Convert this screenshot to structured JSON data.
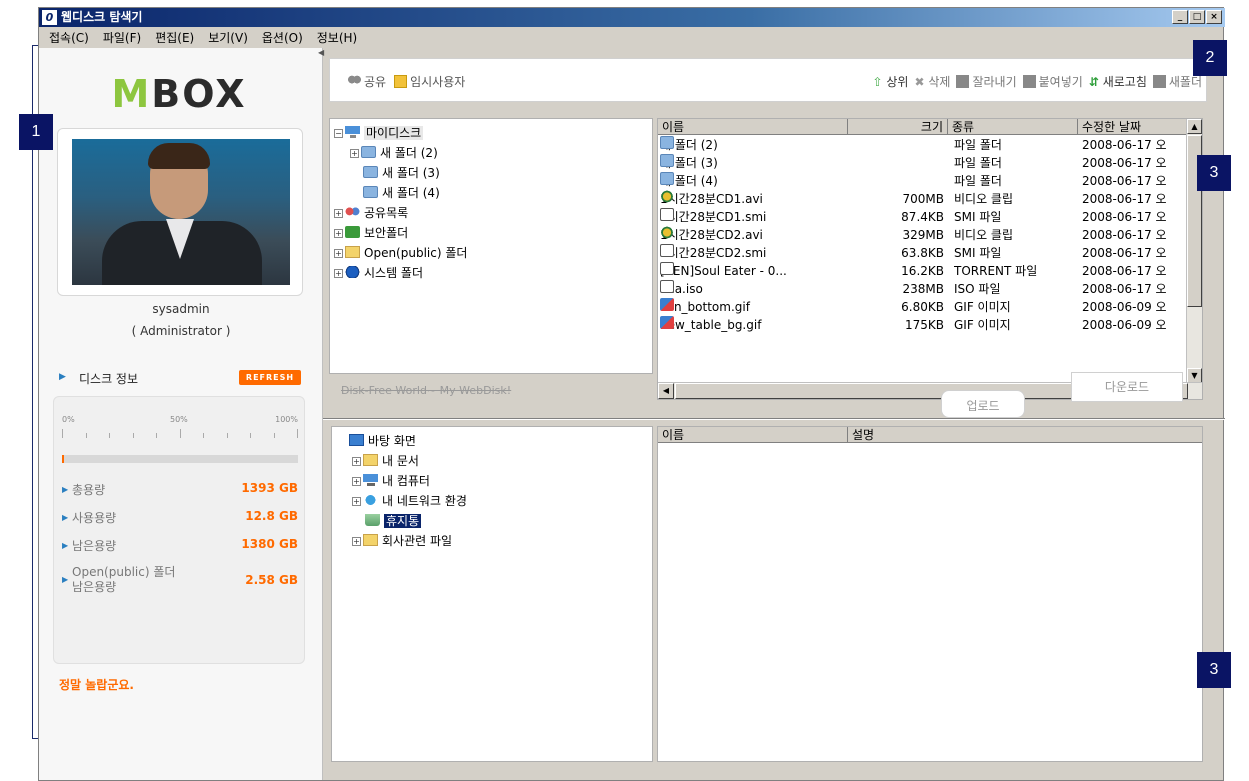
{
  "window": {
    "title": "웹디스크 탐색기",
    "app_icon": "0",
    "controls": [
      "_",
      "□",
      "×"
    ]
  },
  "menu": [
    "접속(C)",
    "파일(F)",
    "편집(E)",
    "보기(V)",
    "옵션(O)",
    "정보(H)"
  ],
  "left_panel": {
    "logo_m": "M",
    "logo_rest": "BOX",
    "username": "sysadmin",
    "role": "( Administrator )",
    "disk_info_label": "디스크 정보",
    "refresh_label": "REFRESH",
    "scale": [
      "0%",
      "50%",
      "100%"
    ],
    "usage_fraction": 0.009,
    "stats": [
      {
        "label": "총용량",
        "value": "1393 GB"
      },
      {
        "label": "사용용량",
        "value": "12.8 GB"
      },
      {
        "label": "남은용량",
        "value": "1380 GB"
      },
      {
        "label": "Open(public) 폴더 남은용량",
        "value": "2.58 GB"
      }
    ],
    "notice": "정말 놀랍군요."
  },
  "toolbar": {
    "share": "공유",
    "temp_user": "임시사용자",
    "up": "상위",
    "delete": "삭제",
    "cut": "잘라내기",
    "paste": "붙여넣기",
    "refresh": "새로고침",
    "new_folder": "새폴더"
  },
  "remote_tree": [
    {
      "label": "마이디스크",
      "indent": 0,
      "pm": "−",
      "icon": "pc",
      "hl": true
    },
    {
      "label": "새 폴더 (2)",
      "indent": 1,
      "pm": "+",
      "icon": "fold"
    },
    {
      "label": "새 폴더 (3)",
      "indent": 1,
      "pm": "",
      "icon": "fold"
    },
    {
      "label": "새 폴더 (4)",
      "indent": 1,
      "pm": "",
      "icon": "fold"
    },
    {
      "label": "공유목록",
      "indent": 0,
      "pm": "+",
      "icon": "share"
    },
    {
      "label": "보안폴더",
      "indent": 0,
      "pm": "+",
      "icon": "sec"
    },
    {
      "label": "Open(public) 폴더",
      "indent": 0,
      "pm": "+",
      "icon": "pub"
    },
    {
      "label": "시스템 폴더",
      "indent": 0,
      "pm": "+",
      "icon": "sys"
    }
  ],
  "remote_list": {
    "columns": [
      "이름",
      "크기",
      "종류",
      "수정한 날짜"
    ],
    "rows": [
      {
        "name": "새 폴더 (2)",
        "size": "",
        "type": "파일 폴더",
        "date": "2008-06-17 오",
        "icon": "folder"
      },
      {
        "name": "새 폴더 (3)",
        "size": "",
        "type": "파일 폴더",
        "date": "2008-06-17 오",
        "icon": "folder"
      },
      {
        "name": "새 폴더 (4)",
        "size": "",
        "type": "파일 폴더",
        "date": "2008-06-17 오",
        "icon": "folder"
      },
      {
        "name": "1시간28분CD1.avi",
        "size": "700MB",
        "type": "비디오 클립",
        "date": "2008-06-17 오",
        "icon": "video"
      },
      {
        "name": "1시간28분CD1.smi",
        "size": "87.4KB",
        "type": "SMI 파일",
        "date": "2008-06-17 오",
        "icon": "txt"
      },
      {
        "name": "1시간28분CD2.avi",
        "size": "329MB",
        "type": "비디오 클립",
        "date": "2008-06-17 오",
        "icon": "video"
      },
      {
        "name": "1시간28분CD2.smi",
        "size": "63.8KB",
        "type": "SMI 파일",
        "date": "2008-06-17 오",
        "icon": "txt"
      },
      {
        "name": "[AEN]Soul Eater - 0...",
        "size": "16.2KB",
        "type": "TORRENT 파일",
        "date": "2008-06-17 오",
        "icon": "txt"
      },
      {
        "name": "aaa.iso",
        "size": "238MB",
        "type": "ISO 파일",
        "date": "2008-06-17 오",
        "icon": "txt"
      },
      {
        "name": "con_bottom.gif",
        "size": "6.80KB",
        "type": "GIF 이미지",
        "date": "2008-06-09 오",
        "icon": "img"
      },
      {
        "name": "new_table_bg.gif",
        "size": "175KB",
        "type": "GIF 이미지",
        "date": "2008-06-09 오",
        "icon": "img"
      }
    ]
  },
  "status_text": "Disk-Free World~ My WebDisk!",
  "upload_label": "업로드",
  "download_label": "다운로드",
  "local_tree": [
    {
      "label": "바탕 화면",
      "indent": 0,
      "pm": "",
      "icon": "desk"
    },
    {
      "label": "내 문서",
      "indent": 1,
      "pm": "+",
      "icon": "doc"
    },
    {
      "label": "내 컴퓨터",
      "indent": 1,
      "pm": "+",
      "icon": "comp"
    },
    {
      "label": "내 네트워크 환경",
      "indent": 1,
      "pm": "+",
      "icon": "net"
    },
    {
      "label": "휴지통",
      "indent": 1,
      "pm": "",
      "icon": "trash",
      "sel": true
    },
    {
      "label": "회사관련 파일",
      "indent": 1,
      "pm": "+",
      "icon": "cfold"
    }
  ],
  "local_list": {
    "columns": [
      "이름",
      "설명"
    ]
  },
  "annotations": [
    "1",
    "2",
    "3",
    "3"
  ]
}
